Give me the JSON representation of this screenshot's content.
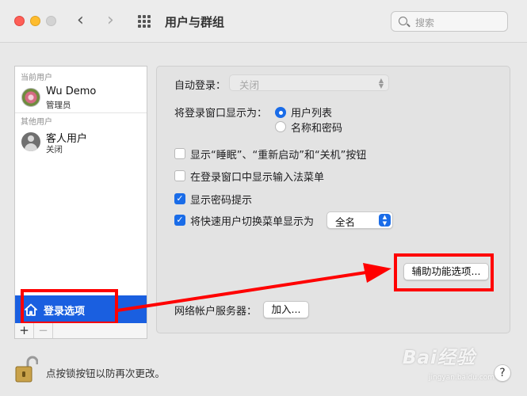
{
  "window": {
    "title": "用户与群组"
  },
  "search": {
    "placeholder": "搜索"
  },
  "sidebar": {
    "current_users_label": "当前用户",
    "other_users_label": "其他用户",
    "users": [
      {
        "name": "Wu Demo",
        "role": "管理员"
      },
      {
        "name": "客人用户",
        "role": "关闭"
      }
    ],
    "login_options_label": "登录选项",
    "add_label": "+",
    "remove_label": "−"
  },
  "main": {
    "auto_login_label": "自动登录：",
    "auto_login_value": "关闭",
    "display_as_label": "将登录窗口显示为：",
    "radio_options": [
      "用户列表",
      "名称和密码"
    ],
    "checkboxes": [
      {
        "label": "显示“睡眠”、“重新启动”和“关机”按钮",
        "checked": false
      },
      {
        "label": "在登录窗口中显示输入法菜单",
        "checked": false
      },
      {
        "label": "显示密码提示",
        "checked": true
      },
      {
        "label": "将快速用户切换菜单显示为",
        "checked": true
      }
    ],
    "fast_switch_value": "全名",
    "accessibility_button": "辅助功能选项...",
    "network_server_label": "网络帐户服务器：",
    "join_button": "加入..."
  },
  "footer": {
    "lock_text": "点按锁按钮以防再次更改。",
    "help_label": "?"
  },
  "watermark": {
    "brand": "Bai经验",
    "url": "jingyan.baidu.com"
  },
  "colors": {
    "accent": "#1a6ce8",
    "selection": "#1a5fe0",
    "annotation": "#ff0000"
  }
}
